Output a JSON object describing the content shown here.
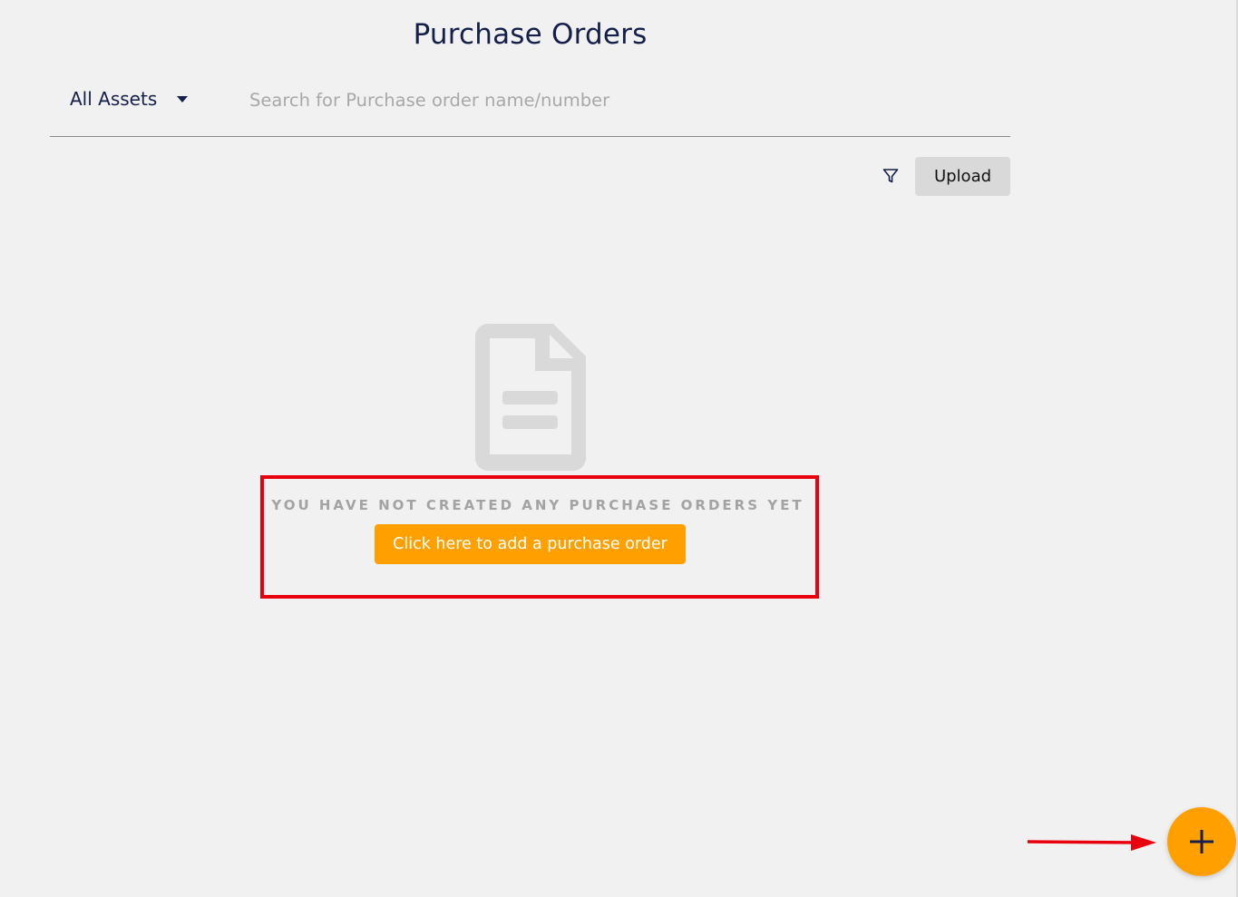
{
  "page": {
    "title": "Purchase Orders"
  },
  "toolbar": {
    "asset_filter_label": "All Assets",
    "search_placeholder": "Search for Purchase order name/number",
    "search_value": "",
    "upload_label": "Upload",
    "filter_icon": "filter-icon"
  },
  "empty_state": {
    "icon": "document-icon",
    "message": "YOU HAVE NOT CREATED ANY PURCHASE ORDERS YET",
    "add_button_label": "Click here to add a purchase order"
  },
  "fab": {
    "icon": "plus-icon"
  },
  "colors": {
    "background": "#f1f1f1",
    "title": "#14204a",
    "accent_orange": "#ffa000",
    "annotation_red": "#e8000e",
    "muted_text": "#a3a3a3",
    "upload_button_bg": "#d9d9d9"
  }
}
